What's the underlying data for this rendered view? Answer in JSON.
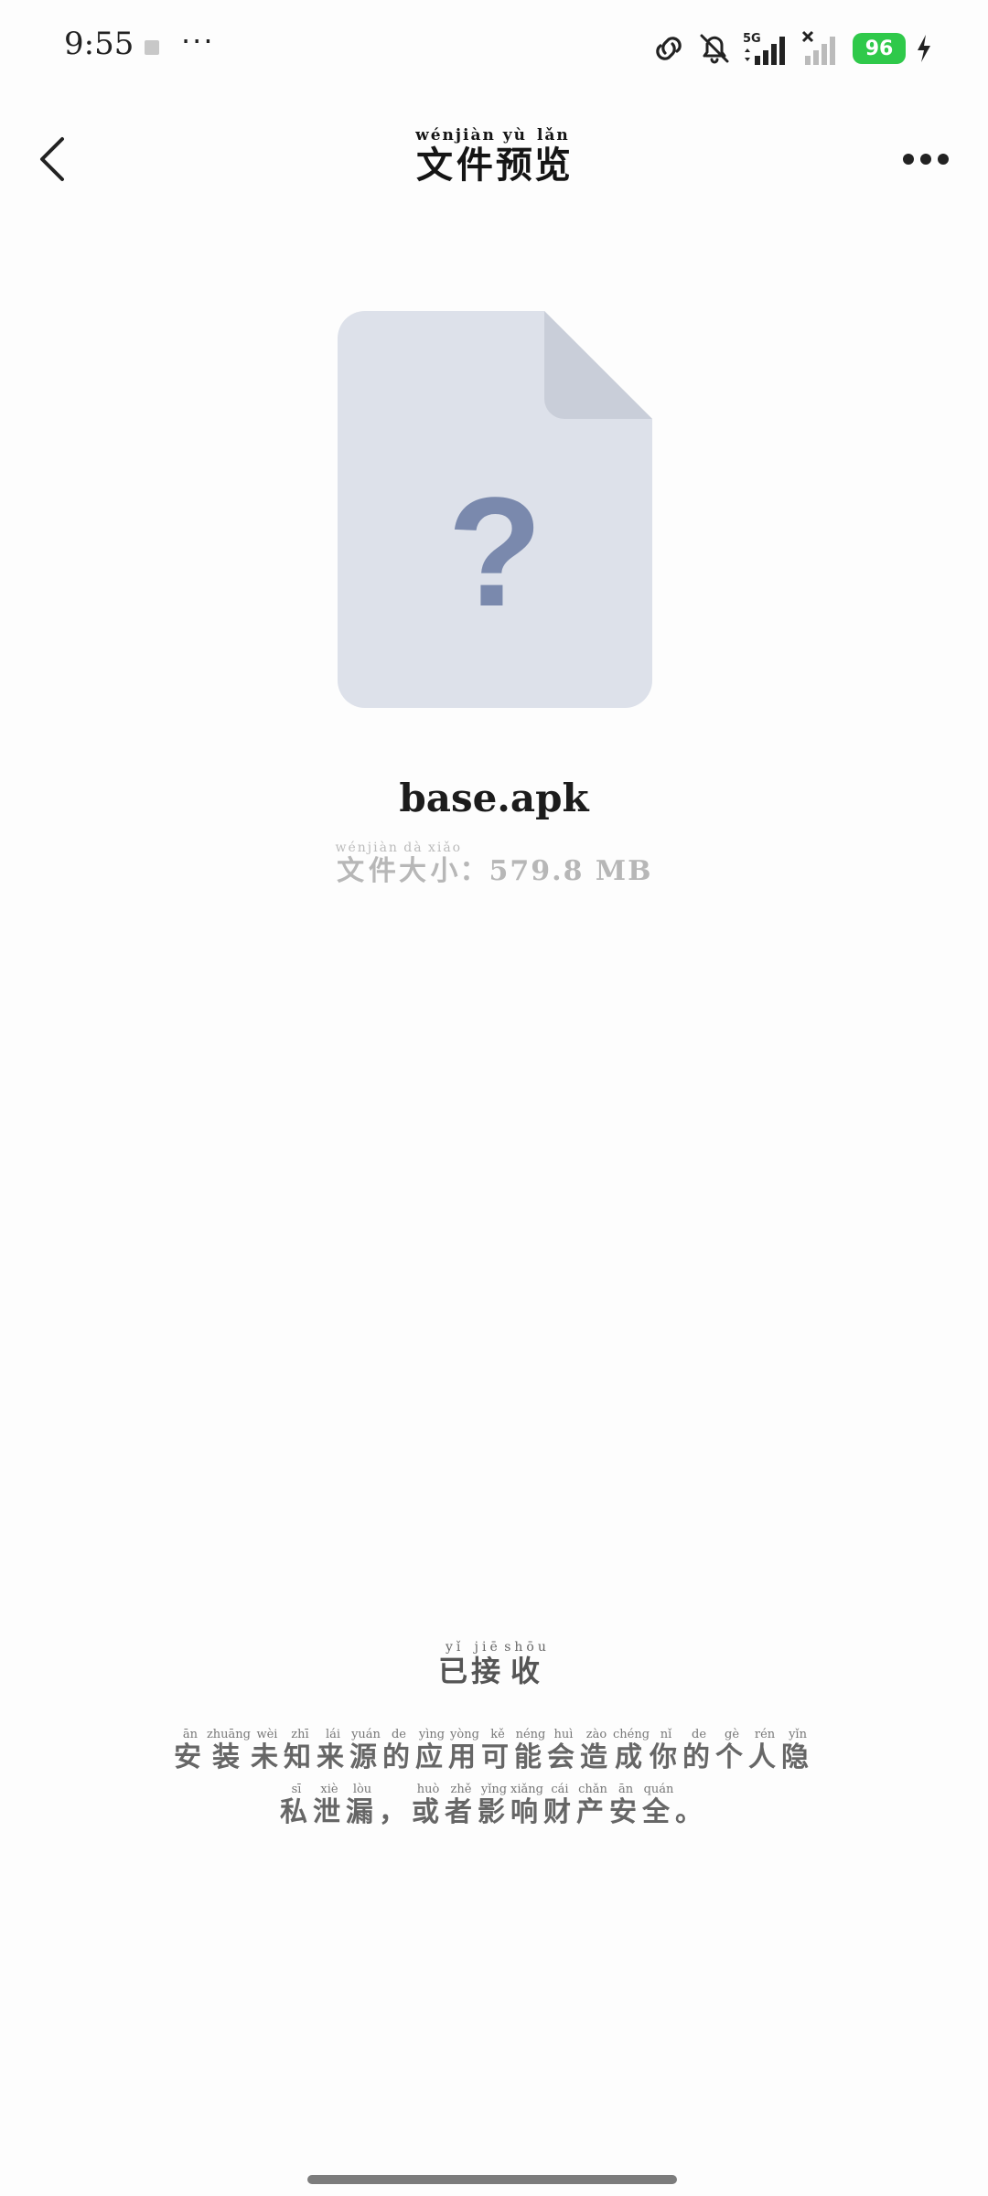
{
  "status_bar": {
    "time": "9:55",
    "more": "···",
    "network": "5G",
    "battery": "96",
    "icons": [
      "link-icon",
      "bell-off-icon",
      "signal-5g-icon",
      "signal-no-service-icon",
      "battery-icon",
      "charging-icon"
    ],
    "battery_color": "#2fc94a"
  },
  "nav": {
    "title": "文件预览",
    "title_pinyin": [
      "wén",
      "jiàn",
      "yù",
      "lǎn"
    ],
    "back_icon": "chevron-left-icon",
    "more_icon": "more-horizontal-icon"
  },
  "file": {
    "icon": "unknown-file-icon",
    "icon_color": "#dde1ea",
    "icon_symbol": "?",
    "icon_symbol_color": "#7a89ad",
    "name": "base.apk",
    "size_label": "文件大小",
    "size_label_pinyin": [
      "wén",
      "jiàn",
      "dà",
      "xiǎo"
    ],
    "size_value": "：579.8 MB"
  },
  "status": {
    "text": "已接收",
    "pinyin": [
      "yǐ",
      "jiē",
      "shōu"
    ]
  },
  "warning": {
    "line1": "安装未知来源的应用可能会造成你的个人隐",
    "line1_pinyin": [
      "ān",
      "zhuāng",
      "wèi",
      "zhī",
      "lái",
      "yuán",
      "de",
      "yìng",
      "yòng",
      "kě",
      "néng",
      "huì",
      "zào",
      "chéng",
      "nǐ",
      "de",
      "gè",
      "rén",
      "yǐn"
    ],
    "line2": "私泄漏，或者影响财产安全。",
    "line2_pinyin": [
      "sī",
      "xiè",
      "lòu",
      "",
      "huò",
      "zhě",
      "yǐng",
      "xiǎng",
      "cái",
      "chǎn",
      "ān",
      "quán",
      ""
    ]
  }
}
